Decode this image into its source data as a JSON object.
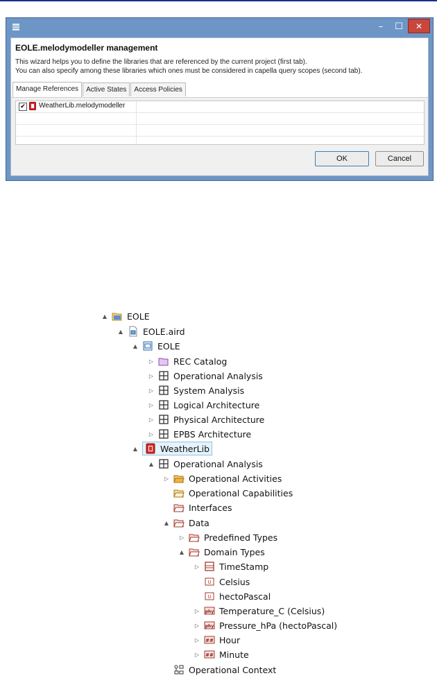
{
  "dialog": {
    "title": "EOLE.melodymodeller management",
    "description_line1": "This wizard helps you to define the libraries that are referenced by the current project (first tab).",
    "description_line2": "You can also specify among these libraries which ones must be considered in capella query scopes (second tab).",
    "tabs": [
      "Manage References",
      "Active States",
      "Access Policies"
    ],
    "active_tab": "Manage References",
    "table_rows": [
      {
        "checked": true,
        "label": "WeatherLib.melodymodeller"
      }
    ],
    "ok_label": "OK",
    "cancel_label": "Cancel",
    "window_controls": {
      "minimize": "–",
      "maximize": "☐",
      "close": "✕"
    },
    "colors": {
      "frame": "#6d96c6",
      "close": "#c9463d"
    }
  },
  "tree": [
    {
      "label": "EOLE",
      "twisty": "▲",
      "icon": "project-folder-icon"
    },
    {
      "label": "EOLE.aird",
      "twisty": "▲",
      "icon": "aird-file-icon"
    },
    {
      "label": "EOLE",
      "twisty": "▲",
      "icon": "model-icon"
    },
    {
      "label": "REC Catalog",
      "twisty": "▷",
      "icon": "catalog-folder-icon"
    },
    {
      "label": "Operational Analysis",
      "twisty": "▷",
      "icon": "architecture-icon"
    },
    {
      "label": "System Analysis",
      "twisty": "▷",
      "icon": "architecture-icon"
    },
    {
      "label": "Logical Architecture",
      "twisty": "▷",
      "icon": "architecture-icon"
    },
    {
      "label": "Physical Architecture",
      "twisty": "▷",
      "icon": "architecture-icon"
    },
    {
      "label": "EPBS Architecture",
      "twisty": "▷",
      "icon": "architecture-icon"
    },
    {
      "label": "WeatherLib",
      "twisty": "▲",
      "icon": "library-icon",
      "selected": true
    },
    {
      "label": "Operational Analysis",
      "twisty": "▲",
      "icon": "architecture-icon"
    },
    {
      "label": "Operational Activities",
      "twisty": "▷",
      "icon": "activities-folder-icon"
    },
    {
      "label": "Operational Capabilities",
      "twisty": "",
      "icon": "capabilities-folder-icon"
    },
    {
      "label": "Interfaces",
      "twisty": "",
      "icon": "interfaces-folder-icon"
    },
    {
      "label": "Data",
      "twisty": "▲",
      "icon": "data-folder-icon"
    },
    {
      "label": "Predefined Types",
      "twisty": "▷",
      "icon": "data-folder-icon"
    },
    {
      "label": "Domain Types",
      "twisty": "▲",
      "icon": "data-folder-icon"
    },
    {
      "label": "TimeStamp",
      "twisty": "▷",
      "icon": "class-icon"
    },
    {
      "label": "Celsius",
      "twisty": "",
      "icon": "unit-icon"
    },
    {
      "label": "hectoPascal",
      "twisty": "",
      "icon": "unit-icon"
    },
    {
      "label": "Temperature_C (Celsius)",
      "twisty": "▷",
      "icon": "physical-quantity-icon"
    },
    {
      "label": "Pressure_hPa (hectoPascal)",
      "twisty": "▷",
      "icon": "physical-quantity-icon"
    },
    {
      "label": "Hour",
      "twisty": "▷",
      "icon": "numeric-type-icon"
    },
    {
      "label": "Minute",
      "twisty": "▷",
      "icon": "numeric-type-icon"
    },
    {
      "label": "Operational Context",
      "twisty": "",
      "icon": "context-icon"
    }
  ]
}
